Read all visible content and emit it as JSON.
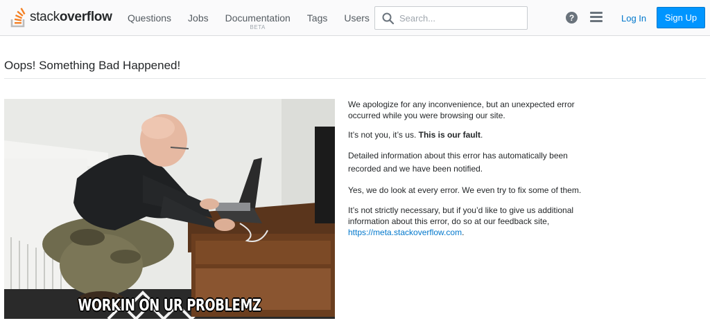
{
  "header": {
    "logo_light": "stack",
    "logo_bold": "overflow",
    "nav": [
      {
        "label": "Questions"
      },
      {
        "label": "Jobs"
      },
      {
        "label": "Documentation",
        "badge": "BETA"
      },
      {
        "label": "Tags"
      },
      {
        "label": "Users"
      }
    ],
    "search_placeholder": "Search...",
    "help_glyph": "?",
    "login_label": "Log In",
    "signup_label": "Sign Up",
    "brand_color": "#f48024",
    "accent_color": "#0095ff"
  },
  "main": {
    "title": "Oops! Something Bad Happened!",
    "image_caption": "WORKIN ON UR PROBLEMZ",
    "p1": "We apologize for any inconvenience, but an unexpected error occurred while you were browsing our site.",
    "p2_prefix": "It’s not you, it’s us. ",
    "p2_bold": "This is our fault",
    "p2_suffix": ".",
    "p3": "Detailed information about this error has automatically been recorded and we have been notified.",
    "p4": "Yes, we do look at every error. We even try to fix some of them.",
    "p5": "It’s not strictly necessary, but if you’d like to give us additional information about this error, do so at our feedback site,",
    "feedback_link": "https://meta.stackoverflow.com",
    "p5_end": "."
  }
}
